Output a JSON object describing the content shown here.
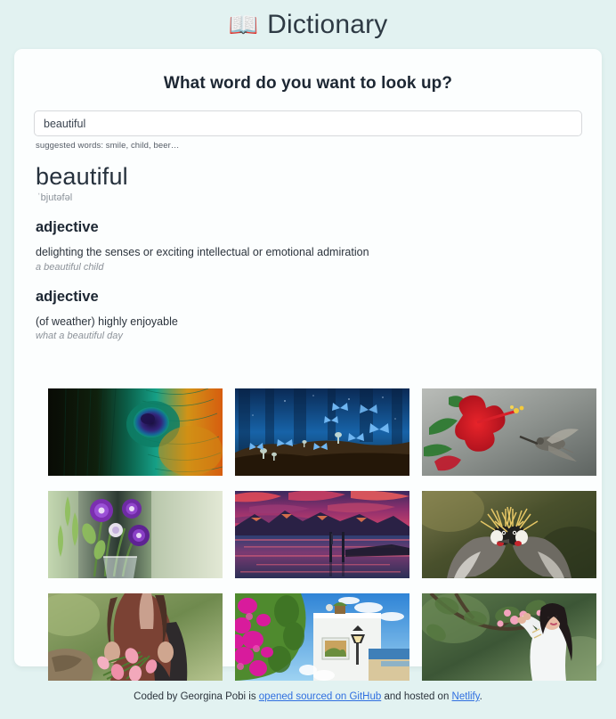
{
  "header": {
    "icon": "open-book-icon",
    "icon_glyph": "📖",
    "title": "Dictionary"
  },
  "search": {
    "heading": "What word do you want to look up?",
    "input_value": "beautiful",
    "placeholder": "",
    "hint": "suggested words: smile, child, beer…"
  },
  "result": {
    "word": "beautiful",
    "phonetic": "ˈbjutəfəl",
    "meanings": [
      {
        "part_of_speech": "adjective",
        "definition": "delighting the senses or exciting intellectual or emotional admiration",
        "example": "a beautiful child"
      },
      {
        "part_of_speech": "adjective",
        "definition": "(of weather) highly enjoyable",
        "example": "what a beautiful day"
      }
    ]
  },
  "photos": [
    {
      "alt": "peacock feather close-up"
    },
    {
      "alt": "blue butterflies in a dark forest"
    },
    {
      "alt": "red hibiscus flower with hummingbird"
    },
    {
      "alt": "purple lisianthus flowers in a glass vase"
    },
    {
      "alt": "sunset over mountain lake with wooden dock"
    },
    {
      "alt": "pair of grey crowned cranes"
    },
    {
      "alt": "woman holding a bunch of pink tulips"
    },
    {
      "alt": "white mediterranean house with magenta bougainvillea"
    },
    {
      "alt": "woman reaching for pink blossoms on a tree"
    }
  ],
  "footer": {
    "text_before": "Coded by Georgina Pobi is ",
    "link_github": "opened sourced on GitHub",
    "text_middle": " and hosted on ",
    "link_netlify": "Netlify",
    "text_after": "."
  },
  "colors": {
    "page_background": "#e2f2f1",
    "card_background": "#fcfefe",
    "heading_text": "#1d2733",
    "muted_text": "#8c9299",
    "link": "#2f6fe0"
  }
}
